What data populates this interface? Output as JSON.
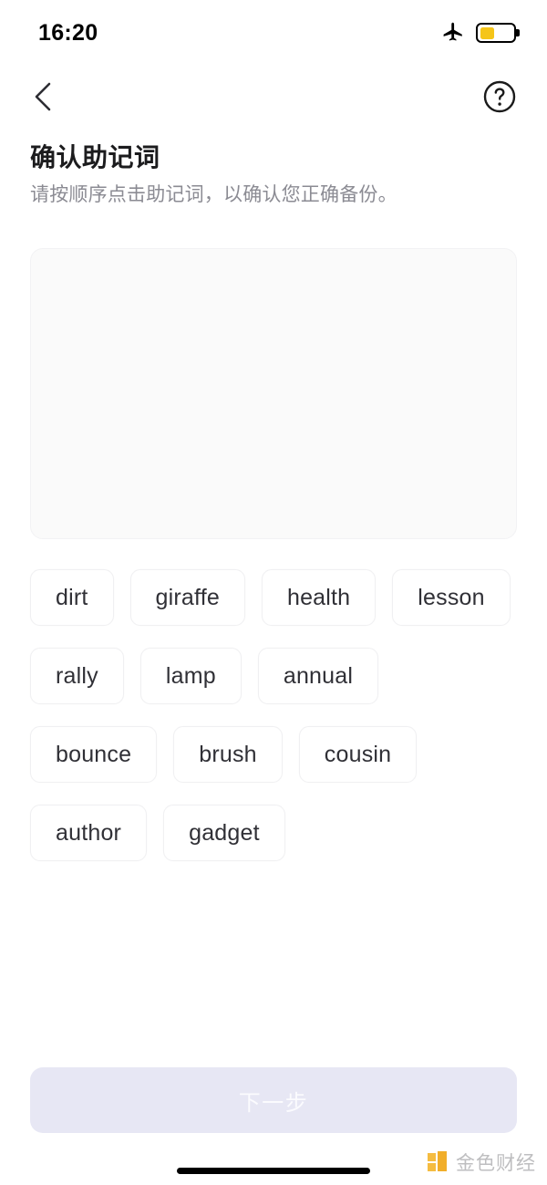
{
  "status_bar": {
    "time": "16:20",
    "airplane_icon": "airplane-icon",
    "battery_icon": "battery-icon",
    "battery_level_percent": 45,
    "battery_color": "#f5c518"
  },
  "nav_bar": {
    "back_icon": "chevron-left-icon",
    "help_icon": "question-circle-icon"
  },
  "header": {
    "title": "确认助记词",
    "subtitle": "请按顺序点击助记词，以确认您正确备份。"
  },
  "answer_area": {
    "selected_words": [],
    "background_color": "#fafafa"
  },
  "word_pool": {
    "words": [
      "dirt",
      "giraffe",
      "health",
      "lesson",
      "rally",
      "lamp",
      "annual",
      "bounce",
      "brush",
      "cousin",
      "author",
      "gadget"
    ]
  },
  "footer": {
    "next_label": "下一步",
    "next_enabled": false,
    "next_bg_color": "#e7e7f4",
    "next_text_color": "#fbfbfe"
  },
  "watermark": {
    "text": "金色财经",
    "mark_color": "#f0a818"
  }
}
